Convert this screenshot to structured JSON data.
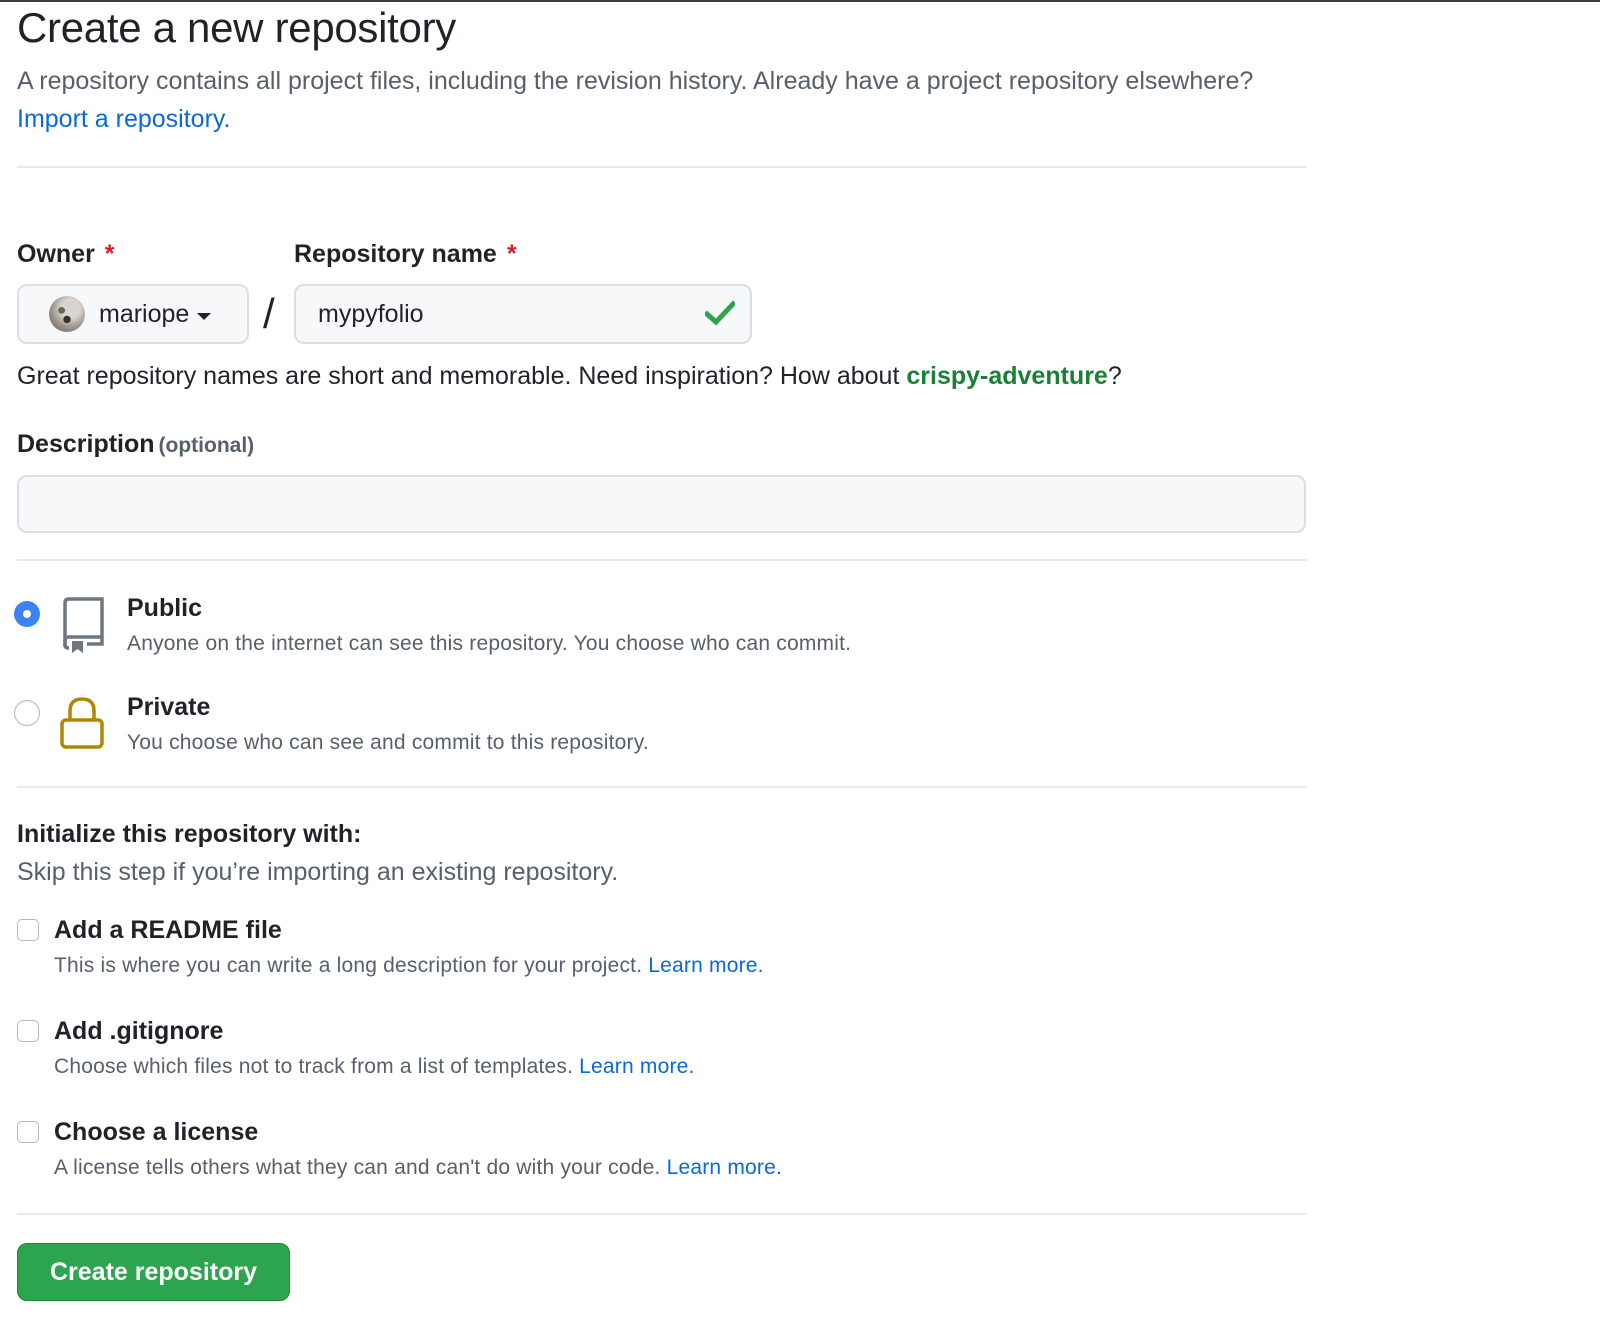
{
  "header": {
    "title": "Create a new repository",
    "subtitle": "A repository contains all project files, including the revision history. Already have a project repository elsewhere?",
    "import_link": "Import a repository."
  },
  "owner": {
    "label": "Owner",
    "required_mark": "*",
    "value": "mariope",
    "avatar": "user-avatar"
  },
  "separator": "/",
  "repo_name": {
    "label": "Repository name",
    "required_mark": "*",
    "value": "mypyfolio",
    "status_icon": "check-icon",
    "status_color": "#2da44e"
  },
  "name_hint": {
    "text": "Great repository names are short and memorable. Need inspiration? How about",
    "suggestion": "crispy-adventure",
    "suffix": "?"
  },
  "description": {
    "label": "Description",
    "optional": "(optional)",
    "value": "",
    "placeholder": ""
  },
  "visibility": {
    "selected": "public",
    "options": [
      {
        "id": "public",
        "title": "Public",
        "description": "Anyone on the internet can see this repository. You choose who can commit.",
        "icon": "repo-icon",
        "checked": true
      },
      {
        "id": "private",
        "title": "Private",
        "description": "You choose who can see and commit to this repository.",
        "icon": "lock-icon",
        "checked": false
      }
    ]
  },
  "initialize": {
    "title": "Initialize this repository with:",
    "subtitle": "Skip this step if you’re importing an existing repository.",
    "options": [
      {
        "title": "Add a README file",
        "description": "This is where you can write a long description for your project.",
        "link": "Learn more.",
        "checked": false
      },
      {
        "title": "Add .gitignore",
        "description": "Choose which files not to track from a list of templates.",
        "link": "Learn more.",
        "checked": false
      },
      {
        "title": "Choose a license",
        "description": "A license tells others what they can and can't do with your code.",
        "link": "Learn more.",
        "checked": false
      }
    ]
  },
  "submit": {
    "label": "Create repository",
    "color": "#2da44e"
  },
  "colors": {
    "link": "#0969da",
    "required": "#cf222e",
    "suggestion": "#1a7f37",
    "radio_selected": "#3b82f6",
    "lock_icon": "#b08800"
  }
}
